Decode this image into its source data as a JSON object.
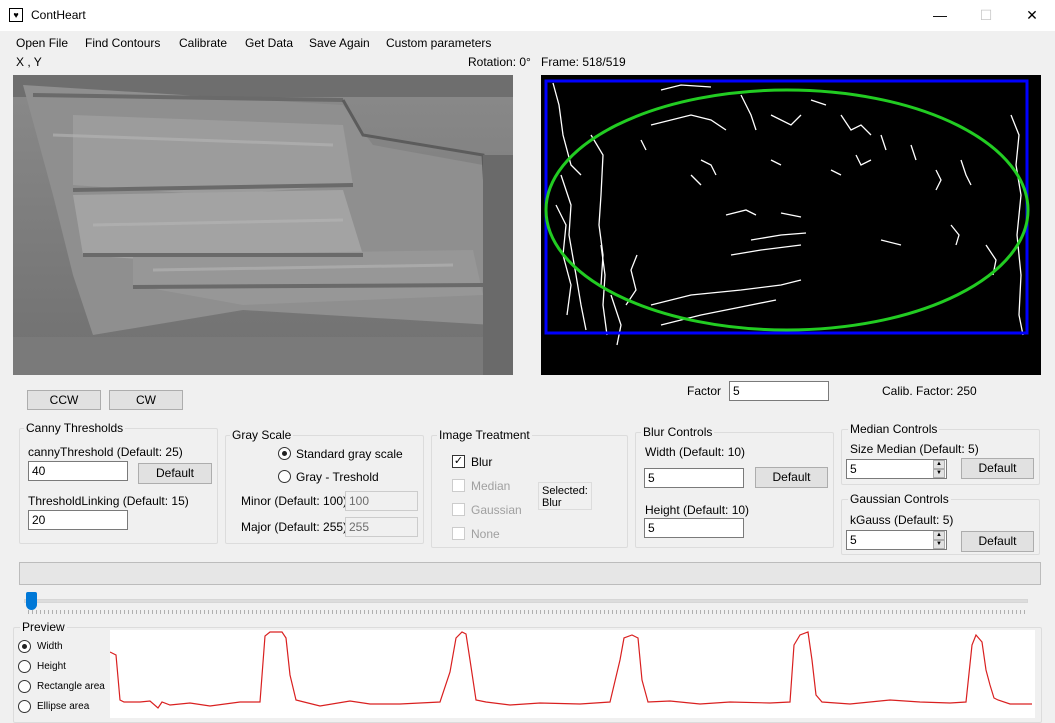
{
  "window": {
    "title": "ContHeart",
    "minimize": "—",
    "maximize": "☐",
    "close": "✕"
  },
  "menu": [
    "Open File",
    "Find Contours",
    "Calibrate",
    "Get Data",
    "Save Again",
    "Custom parameters"
  ],
  "status": {
    "coords": "X , Y",
    "rotation": "Rotation: 0°",
    "frame": "Frame: 518/519"
  },
  "rotate": {
    "ccw": "CCW",
    "cw": "CW"
  },
  "factor": {
    "label": "Factor",
    "value": "5",
    "calib": "Calib. Factor: 250"
  },
  "canny": {
    "title": "Canny Thresholds",
    "threshold_label": "cannyThreshold (Default: 25)",
    "threshold_value": "40",
    "default_button": "Default",
    "linking_label": "ThresholdLinking (Default: 15)",
    "linking_value": "20"
  },
  "gray": {
    "title": "Gray Scale",
    "standard": "Standard gray scale",
    "treshold": "Gray - Treshold",
    "minor_label": "Minor (Default: 100)",
    "minor_value": "100",
    "major_label": "Major (Default: 255)",
    "major_value": "255"
  },
  "treatment": {
    "title": "Image Treatment",
    "blur": "Blur",
    "median": "Median",
    "gaussian": "Gaussian",
    "none": "None",
    "selected": "Selected:\nBlur"
  },
  "blur": {
    "title": "Blur Controls",
    "width_label": "Width (Default: 10)",
    "width_value": "5",
    "default_button": "Default",
    "height_label": "Height (Default: 10)",
    "height_value": "5"
  },
  "median": {
    "title": "Median Controls",
    "size_label": "Size Median (Default: 5)",
    "size_value": "5",
    "default_button": "Default"
  },
  "gaussian": {
    "title": "Gaussian Controls",
    "k_label": "kGauss (Default: 5)",
    "k_value": "5",
    "default_button": "Default"
  },
  "trackbar": {
    "position": 0.0
  },
  "preview": {
    "title": "Preview",
    "options": [
      "Width",
      "Height",
      "Rectangle area",
      "Ellipse area"
    ],
    "selected": "Width",
    "line_color": "#d92020"
  },
  "colors": {
    "rect": "#0000ff",
    "ellipse": "#22cc22",
    "edges": "#ffffff"
  }
}
